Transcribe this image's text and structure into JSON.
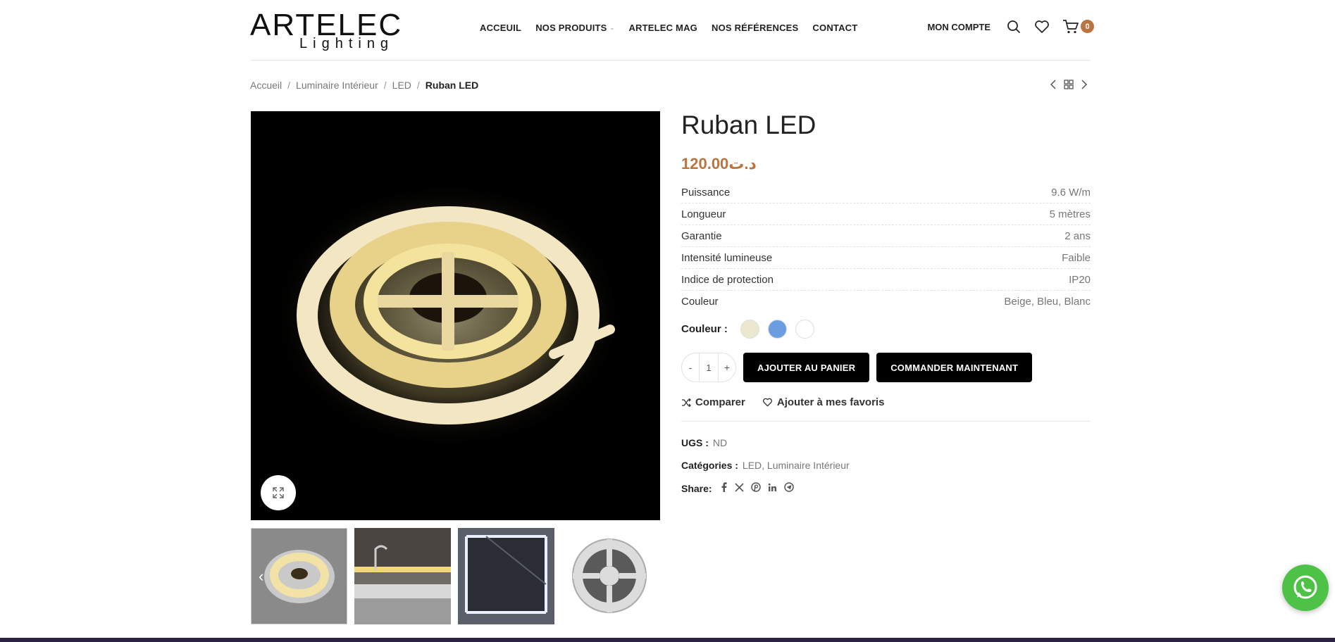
{
  "header": {
    "logo_brand": "ARTELEC",
    "logo_sub": "Lighting",
    "nav": [
      {
        "label": "ACCEUIL"
      },
      {
        "label": "NOS PRODUITS"
      },
      {
        "label": "ARTELEC MAG"
      },
      {
        "label": "NOS RÉFÉRENCES"
      },
      {
        "label": "CONTACT"
      }
    ],
    "account": "MON COMPTE",
    "cart_count": "0",
    "accent_color": "#b9743f"
  },
  "breadcrumb": {
    "items": [
      "Accueil",
      "Luminaire Intérieur",
      "LED"
    ],
    "current": "Ruban LED",
    "separator": "/"
  },
  "product": {
    "title": "Ruban LED",
    "price": "120.00د.ت",
    "attributes": [
      {
        "key": "Puissance",
        "value": "9.6 W/m"
      },
      {
        "key": "Longueur",
        "value": "5 mètres"
      },
      {
        "key": "Garantie",
        "value": "2 ans"
      },
      {
        "key": "Intensité lumineuse",
        "value": "Faible"
      },
      {
        "key": "Indice de protection",
        "value": "IP20"
      },
      {
        "key": "Couleur",
        "value": "Beige, Bleu, Blanc"
      }
    ],
    "swatch_label": "Couleur :",
    "swatches": [
      {
        "name": "Beige",
        "color": "#ece8cf"
      },
      {
        "name": "Bleu",
        "color": "#6a9ee0"
      },
      {
        "name": "Blanc",
        "color": "#ffffff"
      }
    ],
    "quantity": "1",
    "qty_minus": "-",
    "qty_plus": "+",
    "add_to_cart": "AJOUTER AU PANIER",
    "order_now": "COMMANDER MAINTENANT",
    "compare": "Comparer",
    "wishlist": "Ajouter à mes favoris",
    "sku_label": "UGS :",
    "sku": "ND",
    "categories_label": "Catégories :",
    "categories": "LED, Luminaire Intérieur",
    "share_label": "Share:",
    "share_icons": [
      "facebook-icon",
      "x-icon",
      "pinterest-icon",
      "linkedin-icon",
      "telegram-icon"
    ]
  }
}
